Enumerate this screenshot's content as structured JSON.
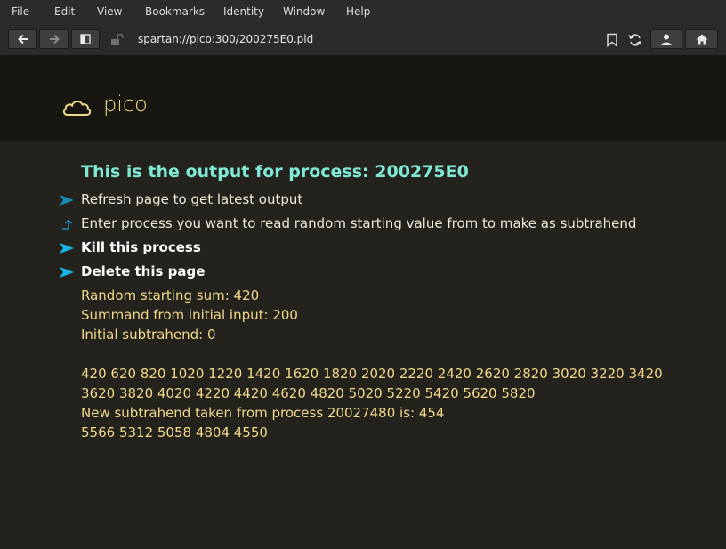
{
  "menu": [
    "File",
    "Edit",
    "View",
    "Bookmarks",
    "Identity",
    "Window",
    "Help"
  ],
  "address": {
    "url": "spartan://pico:300/200275E0.pid"
  },
  "site": {
    "title": "pico"
  },
  "page": {
    "heading": "This is the output for process: 200275E0",
    "links": [
      {
        "label": "Refresh page to get latest output",
        "icon": "arrow-link-icon"
      },
      {
        "label": "Enter process you want to read random starting value from to make as subtrahend",
        "icon": "return-input-icon"
      },
      {
        "label": "Kill this process",
        "icon": "arrow-link-icon"
      },
      {
        "label": "Delete this page",
        "icon": "arrow-link-icon"
      }
    ],
    "output_lines": [
      "Random starting sum: 420",
      "Summand from initial input: 200",
      "Initial subtrahend: 0",
      "",
      "420 620 820 1020 1220 1420 1620 1820 2020 2220 2420 2620 2820 3020 3220 3420",
      "3620 3820 4020 4220 4420 4620 4820 5020 5220 5420 5620 5820",
      "New subtrahend taken from process 20027480 is: 454",
      "5566 5312 5058 4804 4550"
    ]
  },
  "colors": {
    "accent_arrow": "#1bb6e8",
    "heading": "#7fe9d4",
    "output_text": "#f2d98a",
    "page_background": "#24221d"
  }
}
